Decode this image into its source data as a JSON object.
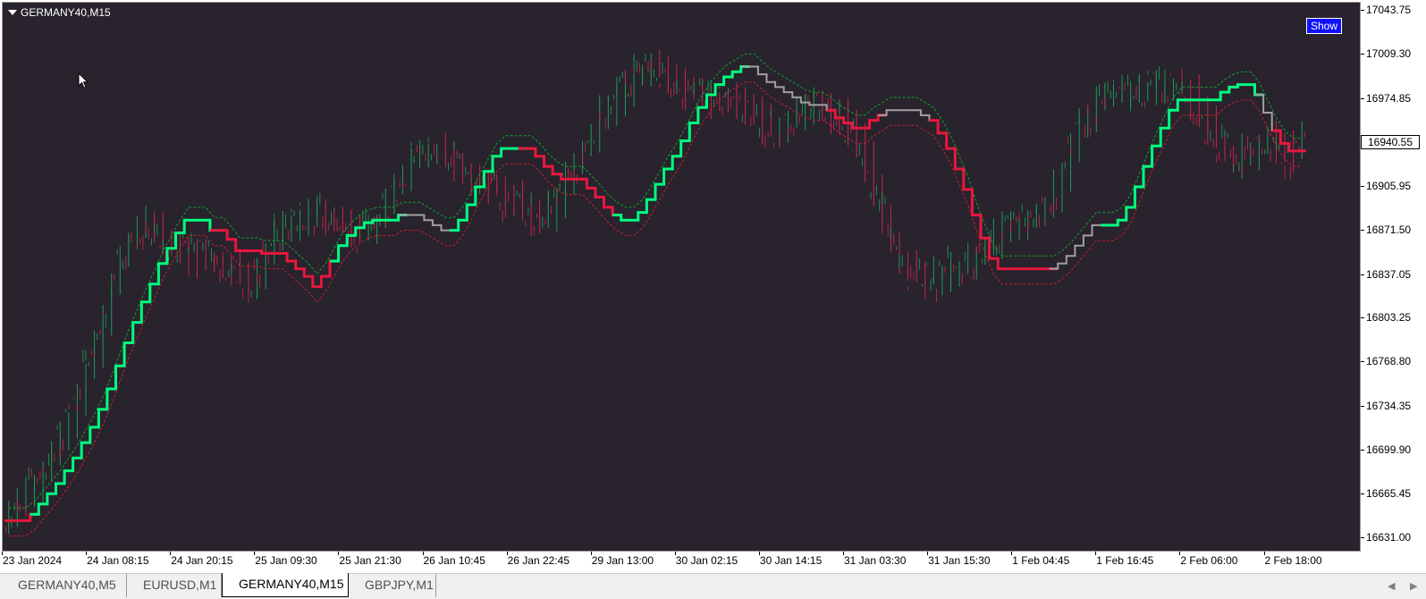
{
  "window": {
    "symbol_title": "GERMANY40,M15",
    "show_button_label": "Show",
    "current_price_label": "16940.55",
    "current_price": 16940.55
  },
  "tabs": [
    {
      "label": "GERMANY40,M5",
      "active": false
    },
    {
      "label": "EURUSD,M1",
      "active": false
    },
    {
      "label": "GERMANY40,M15",
      "active": true
    },
    {
      "label": "GBPJPY,M1",
      "active": false
    }
  ],
  "colors": {
    "background": "#28232d",
    "bull_candle": "#1f9d55",
    "bear_candle": "#c8264b",
    "trend_up": "#00ff7f",
    "trend_down": "#e8173e",
    "trend_neutral": "#a0a0a0",
    "band_upper": "#12a02a",
    "band_lower": "#c8202e"
  },
  "chart_data": {
    "type": "line",
    "symbol": "GERMANY40",
    "timeframe": "M15",
    "y_tick_labels": [
      "17043.75",
      "17009.30",
      "16974.85",
      "16940.55",
      "16905.95",
      "16871.50",
      "16837.05",
      "16803.25",
      "16768.80",
      "16734.35",
      "16699.90",
      "16665.45",
      "16631.00"
    ],
    "y_ticks": [
      17043.75,
      17009.3,
      16974.85,
      16940.55,
      16905.95,
      16871.5,
      16837.05,
      16803.25,
      16768.8,
      16734.35,
      16699.9,
      16665.45,
      16631.0
    ],
    "ylim": [
      16621.5,
      17050.0
    ],
    "x_tick_labels": [
      "23 Jan 2024",
      "24 Jan 08:15",
      "24 Jan 20:15",
      "25 Jan 09:30",
      "25 Jan 21:30",
      "26 Jan 10:45",
      "26 Jan 22:45",
      "29 Jan 13:00",
      "30 Jan 02:15",
      "30 Jan 14:15",
      "31 Jan 03:30",
      "31 Jan 15:30",
      "1 Feb 04:45",
      "1 Feb 16:45",
      "2 Feb 06:00",
      "2 Feb 18:00"
    ],
    "bar_count": 152,
    "grid": false,
    "series": [
      {
        "kind": "price_close",
        "values": [
          16650,
          16658,
          16666,
          16675,
          16685,
          16698,
          16710,
          16725,
          16742,
          16760,
          16782,
          16806,
          16828,
          16848,
          16862,
          16872,
          16876,
          16872,
          16866,
          16860,
          16856,
          16854,
          16852,
          16850,
          16848,
          16846,
          16842,
          16836,
          16830,
          16840,
          16856,
          16866,
          16872,
          16876,
          16880,
          16884,
          16886,
          16884,
          16880,
          16876,
          16872,
          16868,
          16870,
          16880,
          16892,
          16906,
          16918,
          16928,
          16932,
          16934,
          16934,
          16930,
          16924,
          16918,
          16914,
          16912,
          16910,
          16906,
          16900,
          16894,
          16888,
          16882,
          16878,
          16885,
          16896,
          16910,
          16922,
          16936,
          16950,
          16962,
          16970,
          16978,
          16986,
          16992,
          16996,
          17000,
          16996,
          16992,
          16986,
          16982,
          16980,
          16978,
          16976,
          16974,
          16972,
          16970,
          16966,
          16962,
          16956,
          16950,
          16952,
          16958,
          16964,
          16968,
          16970,
          16968,
          16964,
          16960,
          16952,
          16940,
          16925,
          16905,
          16885,
          16866,
          16850,
          16840,
          16836,
          16834,
          16836,
          16838,
          16840,
          16842,
          16846,
          16852,
          16858,
          16864,
          16870,
          16874,
          16876,
          16878,
          16882,
          16890,
          16902,
          16918,
          16934,
          16950,
          16962,
          16970,
          16974,
          16976,
          16978,
          16978,
          16980,
          16982,
          16984,
          16986,
          16986,
          16984,
          16976,
          16964,
          16952,
          16942,
          16934,
          16928,
          16930,
          16936,
          16940,
          16942,
          16938,
          16934,
          16932,
          16940
        ]
      },
      {
        "kind": "trend_stepline",
        "values": [
          16645,
          16645,
          16645,
          16650,
          16658,
          16666,
          16674,
          16684,
          16694,
          16706,
          16718,
          16732,
          16748,
          16766,
          16784,
          16800,
          16816,
          16830,
          16846,
          16858,
          16870,
          16880,
          16880,
          16880,
          16872,
          16872,
          16865,
          16856,
          16856,
          16856,
          16854,
          16854,
          16854,
          16848,
          16842,
          16836,
          16828,
          16836,
          16848,
          16860,
          16868,
          16874,
          16878,
          16880,
          16880,
          16880,
          16884,
          16884,
          16884,
          16880,
          16876,
          16872,
          16872,
          16880,
          16892,
          16906,
          16918,
          16930,
          16936,
          16936,
          16936,
          16936,
          16930,
          16922,
          16916,
          16912,
          16912,
          16912,
          16905,
          16898,
          16890,
          16884,
          16880,
          16880,
          16886,
          16896,
          16908,
          16920,
          16930,
          16942,
          16956,
          16968,
          16978,
          16986,
          16992,
          16996,
          17000,
          17000,
          16994,
          16988,
          16984,
          16980,
          16976,
          16972,
          16970,
          16970,
          16966,
          16960,
          16956,
          16952,
          16952,
          16958,
          16962,
          16966,
          16966,
          16966,
          16966,
          16962,
          16958,
          16948,
          16936,
          16920,
          16904,
          16884,
          16866,
          16850,
          16842,
          16842,
          16842,
          16842,
          16842,
          16842,
          16842,
          16846,
          16852,
          16860,
          16868,
          16876,
          16876,
          16876,
          16880,
          16890,
          16906,
          16922,
          16938,
          16952,
          16966,
          16974,
          16974,
          16974,
          16974,
          16974,
          16980,
          16984,
          16986,
          16986,
          16978,
          16964,
          16950,
          16940,
          16934,
          16934
        ]
      },
      {
        "kind": "band_upper",
        "offset": 10
      },
      {
        "kind": "band_lower",
        "offset": -12
      }
    ],
    "trend_segments": [
      {
        "from": 0,
        "to": 3,
        "state": "down"
      },
      {
        "from": 3,
        "to": 24,
        "state": "up"
      },
      {
        "from": 24,
        "to": 38,
        "state": "down"
      },
      {
        "from": 38,
        "to": 46,
        "state": "up"
      },
      {
        "from": 46,
        "to": 52,
        "state": "neutral"
      },
      {
        "from": 52,
        "to": 60,
        "state": "up"
      },
      {
        "from": 60,
        "to": 71,
        "state": "down"
      },
      {
        "from": 71,
        "to": 86,
        "state": "up"
      },
      {
        "from": 86,
        "to": 96,
        "state": "neutral"
      },
      {
        "from": 96,
        "to": 102,
        "state": "down"
      },
      {
        "from": 102,
        "to": 108,
        "state": "neutral"
      },
      {
        "from": 108,
        "to": 122,
        "state": "down"
      },
      {
        "from": 122,
        "to": 128,
        "state": "neutral"
      },
      {
        "from": 128,
        "to": 146,
        "state": "up"
      },
      {
        "from": 146,
        "to": 148,
        "state": "neutral"
      },
      {
        "from": 148,
        "to": 152,
        "state": "down"
      }
    ]
  }
}
